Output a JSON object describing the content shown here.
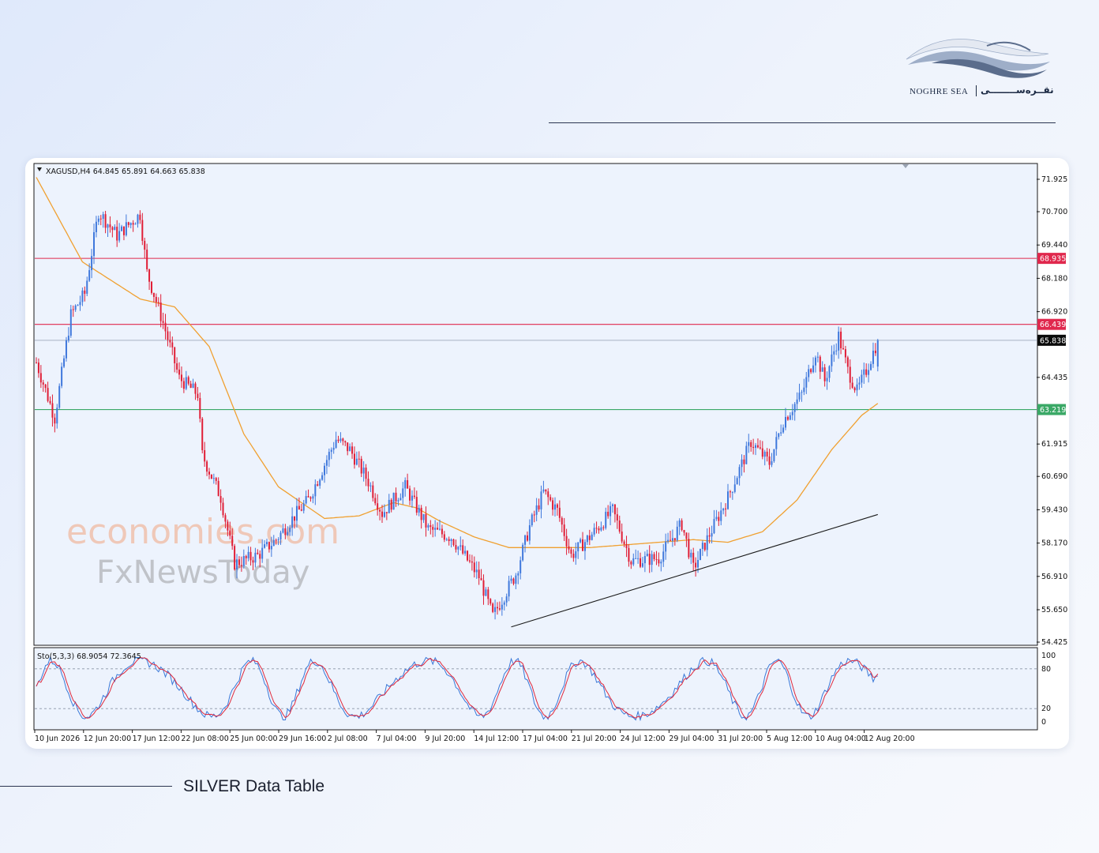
{
  "brand": {
    "name_en": "NOGHRE SEA",
    "name_fa": "نقــره‌ســــــــی",
    "colors": {
      "wave_light": "#e4e9f2",
      "wave_mid": "#9eaec8",
      "wave_dark": "#5b6d8c"
    }
  },
  "footer": {
    "title": "SILVER Data Table"
  },
  "watermark": {
    "line1": "economies.com",
    "line2": "FxNewsToday"
  },
  "chart_data": {
    "type": "candlestick",
    "symbol_header": "XAGUSD,H4  64.845 65.891 64.663 65.838",
    "ohlc": {
      "open": 64.845,
      "high": 65.891,
      "low": 64.663,
      "close": 65.838
    },
    "y_ticks": [
      "71.925",
      "70.700",
      "69.440",
      "68.180",
      "66.920",
      "64.435",
      "61.915",
      "60.690",
      "59.430",
      "58.170",
      "56.910",
      "55.650",
      "54.425"
    ],
    "ylim": [
      54.425,
      71.925
    ],
    "x_labels": [
      "10 Jun 2026",
      "12 Jun 20:00",
      "17 Jun 12:00",
      "22 Jun 08:00",
      "25 Jun 00:00",
      "29 Jun 16:00",
      "2 Jul 08:00",
      "7 Jul 04:00",
      "9 Jul 20:00",
      "14 Jul 12:00",
      "17 Jul 04:00",
      "21 Jul 20:00",
      "24 Jul 12:00",
      "29 Jul 04:00",
      "31 Jul 20:00",
      "5 Aug 12:00",
      "10 Aug 04:00",
      "12 Aug 20:00"
    ],
    "levels": [
      {
        "label": "68.935",
        "value": 68.935,
        "color": "#e0284d"
      },
      {
        "label": "66.439",
        "value": 66.439,
        "color": "#e0284d"
      },
      {
        "label": "65.838",
        "value": 65.838,
        "color": "#0b0b0b"
      },
      {
        "label": "63.219",
        "value": 63.219,
        "color": "#3aa866"
      }
    ],
    "colors": {
      "up": "#3f78dc",
      "down": "#e01e36",
      "ma": "#f0a030",
      "trend": "#1a1a1a"
    },
    "price_path": [
      [
        0,
        65.0
      ],
      [
        8,
        62.9
      ],
      [
        15,
        66.8
      ],
      [
        21,
        67.6
      ],
      [
        27,
        70.7
      ],
      [
        35,
        69.8
      ],
      [
        45,
        70.6
      ],
      [
        48,
        68.4
      ],
      [
        55,
        66.5
      ],
      [
        62,
        64.4
      ],
      [
        70,
        63.8
      ],
      [
        72,
        61.5
      ],
      [
        80,
        59.9
      ],
      [
        86,
        57.4
      ],
      [
        96,
        57.7
      ],
      [
        104,
        58.3
      ],
      [
        112,
        59.2
      ],
      [
        118,
        59.8
      ],
      [
        130,
        62.1
      ],
      [
        136,
        61.7
      ],
      [
        144,
        60.5
      ],
      [
        150,
        59.3
      ],
      [
        160,
        60.3
      ],
      [
        170,
        58.7
      ],
      [
        180,
        58.4
      ],
      [
        192,
        56.9
      ],
      [
        198,
        55.4
      ],
      [
        208,
        57.0
      ],
      [
        214,
        58.8
      ],
      [
        220,
        60.1
      ],
      [
        226,
        59.4
      ],
      [
        232,
        57.7
      ],
      [
        240,
        58.4
      ],
      [
        250,
        59.4
      ],
      [
        258,
        57.5
      ],
      [
        270,
        57.6
      ],
      [
        280,
        58.9
      ],
      [
        285,
        57.2
      ],
      [
        292,
        58.5
      ],
      [
        300,
        59.9
      ],
      [
        310,
        62.0
      ],
      [
        318,
        61.2
      ],
      [
        324,
        62.8
      ],
      [
        332,
        63.8
      ],
      [
        338,
        65.4
      ],
      [
        342,
        64.3
      ],
      [
        348,
        66.0
      ],
      [
        352,
        64.7
      ],
      [
        356,
        63.9
      ],
      [
        360,
        64.7
      ],
      [
        365,
        65.84
      ]
    ],
    "ma_path": [
      [
        0,
        72.0
      ],
      [
        20,
        68.8
      ],
      [
        45,
        67.4
      ],
      [
        60,
        67.1
      ],
      [
        75,
        65.6
      ],
      [
        90,
        62.3
      ],
      [
        105,
        60.3
      ],
      [
        125,
        59.1
      ],
      [
        140,
        59.2
      ],
      [
        155,
        59.7
      ],
      [
        165,
        59.5
      ],
      [
        175,
        59.0
      ],
      [
        190,
        58.4
      ],
      [
        205,
        58.0
      ],
      [
        220,
        58.0
      ],
      [
        240,
        58.0
      ],
      [
        255,
        58.1
      ],
      [
        270,
        58.2
      ],
      [
        285,
        58.3
      ],
      [
        300,
        58.2
      ],
      [
        315,
        58.6
      ],
      [
        330,
        59.8
      ],
      [
        345,
        61.7
      ],
      [
        358,
        63.0
      ],
      [
        365,
        63.45
      ]
    ],
    "trendline": [
      [
        206,
        55.0
      ],
      [
        365,
        59.25
      ]
    ],
    "stochastic": {
      "label": "Sto(5,3,3) 68.9054 72.3645",
      "k": 68.9054,
      "d": 72.3645,
      "y_ticks": [
        "100",
        "80",
        "20",
        "0"
      ],
      "levels": [
        80,
        20
      ],
      "k_color": "#3a78d8",
      "d_color": "#e0283c"
    }
  }
}
